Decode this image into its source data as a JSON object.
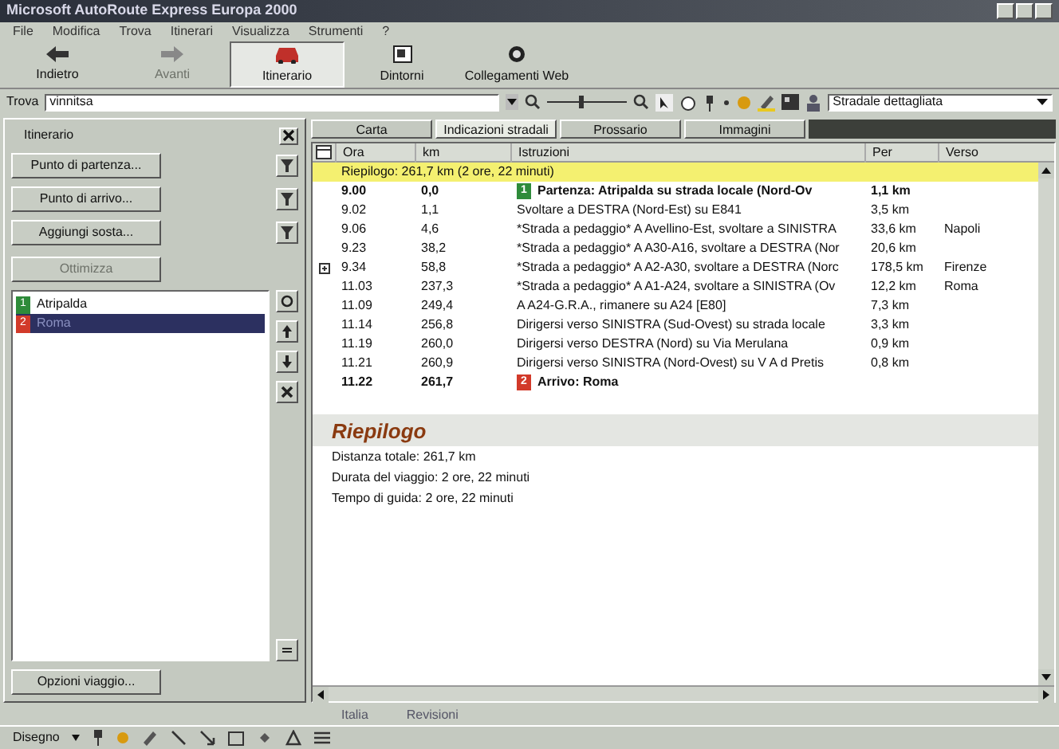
{
  "window": {
    "title": "Microsoft AutoRoute Express Europa 2000"
  },
  "menu": [
    "File",
    "Modifica",
    "Trova",
    "Itinerari",
    "Visualizza",
    "Strumenti",
    "?"
  ],
  "toolbar": [
    {
      "label": "Indietro",
      "kind": "back",
      "selected": false,
      "disabled": false
    },
    {
      "label": "Avanti",
      "kind": "forward",
      "selected": false,
      "disabled": true
    },
    {
      "label": "Itinerario",
      "kind": "car",
      "selected": true,
      "disabled": false
    },
    {
      "label": "Dintorni",
      "kind": "area",
      "selected": false,
      "disabled": false
    },
    {
      "label": "Collegamenti Web",
      "kind": "web",
      "selected": false,
      "disabled": false
    }
  ],
  "find": {
    "label": "Trova",
    "value": "vinnitsa"
  },
  "map_style": {
    "value": "Stradale dettagliata"
  },
  "itinerary_panel": {
    "title": "Itinerario",
    "buttons": [
      {
        "label": "Punto di partenza..."
      },
      {
        "label": "Punto di arrivo..."
      },
      {
        "label": "Aggiungi sosta..."
      }
    ],
    "optimize": {
      "label": "Ottimizza",
      "disabled": true
    },
    "stops": [
      {
        "number": "1",
        "name": "Atripalda",
        "color": "#2e8b3a",
        "selected": false
      },
      {
        "number": "2",
        "name": "Roma",
        "color": "#d23a2a",
        "selected": true
      }
    ],
    "options_button": "Opzioni viaggio..."
  },
  "tabs": [
    {
      "label": "Carta",
      "selected": false
    },
    {
      "label": "Indicazioni stradali",
      "selected": true
    },
    {
      "label": "Prossario",
      "selected": false
    },
    {
      "label": "Immagini",
      "selected": false
    }
  ],
  "table": {
    "columns": [
      "Ora",
      "km",
      "Istruzioni",
      "Per",
      "Verso"
    ],
    "summary": "Riepilogo:  261,7 km (2 ore, 22 minuti)",
    "rows": [
      {
        "time": "9.00",
        "km": "0,0",
        "instruction": "Partenza: Atripalda su strada locale (Nord-Ov",
        "per": "1,1 km",
        "verso": "",
        "bold": true,
        "expandable": false,
        "marker": {
          "number": "1",
          "color": "#2e8b3a"
        }
      },
      {
        "time": "9.02",
        "km": "1,1",
        "instruction": "Svoltare a DESTRA (Nord-Est) su E841",
        "per": "3,5 km",
        "verso": "",
        "bold": false,
        "expandable": false
      },
      {
        "time": "9.06",
        "km": "4,6",
        "instruction": "*Strada a pedaggio* A Avellino-Est, svoltare a SINISTRA",
        "per": "33,6 km",
        "verso": "Napoli",
        "bold": false,
        "expandable": false
      },
      {
        "time": "9.23",
        "km": "38,2",
        "instruction": "*Strada a pedaggio* A A30-A16, svoltare a DESTRA (Nor",
        "per": "20,6 km",
        "verso": "",
        "bold": false,
        "expandable": false
      },
      {
        "time": "9.34",
        "km": "58,8",
        "instruction": "*Strada a pedaggio* A A2-A30, svoltare a DESTRA (Norc",
        "per": "178,5 km",
        "verso": "Firenze",
        "bold": false,
        "expandable": true
      },
      {
        "time": "11.03",
        "km": "237,3",
        "instruction": "*Strada a pedaggio* A A1-A24, svoltare a SINISTRA (Ov",
        "per": "12,2 km",
        "verso": "Roma",
        "bold": false,
        "expandable": false
      },
      {
        "time": "11.09",
        "km": "249,4",
        "instruction": "A A24-G.R.A., rimanere su A24 [E80]",
        "per": "7,3 km",
        "verso": "",
        "bold": false,
        "expandable": false
      },
      {
        "time": "11.14",
        "km": "256,8",
        "instruction": "Dirigersi verso SINISTRA (Sud-Ovest) su strada locale",
        "per": "3,3 km",
        "verso": "",
        "bold": false,
        "expandable": false
      },
      {
        "time": "11.19",
        "km": "260,0",
        "instruction": "Dirigersi verso DESTRA (Nord) su Via Merulana",
        "per": "0,9 km",
        "verso": "",
        "bold": false,
        "expandable": false
      },
      {
        "time": "11.21",
        "km": "260,9",
        "instruction": "Dirigersi verso SINISTRA (Nord-Ovest) su V A d Pretis",
        "per": "0,8 km",
        "verso": "",
        "bold": false,
        "expandable": false
      },
      {
        "time": "11.22",
        "km": "261,7",
        "instruction": "Arrivo: Roma",
        "per": "",
        "verso": "",
        "bold": true,
        "expandable": false,
        "marker": {
          "number": "2",
          "color": "#d23a2a"
        }
      }
    ]
  },
  "recap": {
    "title": "Riepilogo",
    "lines": [
      "Distanza totale:  261,7 km",
      "Durata del viaggio:  2 ore, 22 minuti",
      "Tempo di guida:  2 ore, 22 minuti"
    ]
  },
  "status": [
    "Italia",
    "Revisioni"
  ],
  "drawing_toolbar": {
    "label": "Disegno"
  }
}
